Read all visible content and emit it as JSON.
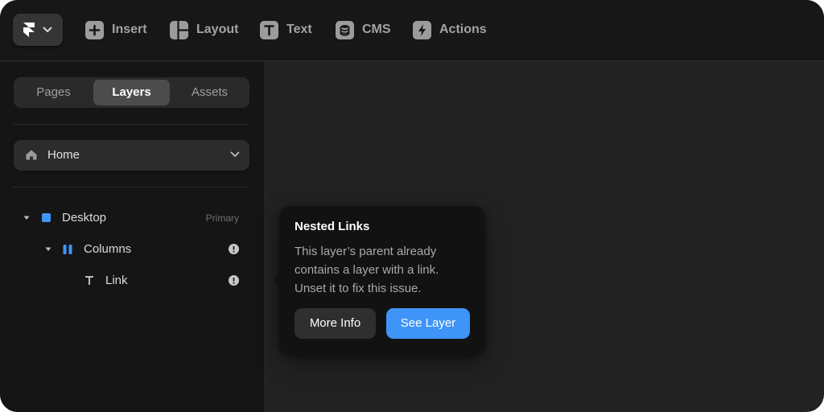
{
  "colors": {
    "accent": "#3f95f7",
    "canvas": "#222222",
    "toolbar_bg": "#171717",
    "sidebar_bg": "#151515",
    "popover_bg": "#121212"
  },
  "toolbar": {
    "logo_icon": "framer-logo-icon",
    "logo_menu_icon": "chevron-down-icon",
    "items": [
      {
        "label": "Insert",
        "icon": "plus-icon"
      },
      {
        "label": "Layout",
        "icon": "layout-icon"
      },
      {
        "label": "Text",
        "icon": "text-icon"
      },
      {
        "label": "CMS",
        "icon": "database-icon"
      },
      {
        "label": "Actions",
        "icon": "bolt-icon"
      }
    ]
  },
  "sidebar": {
    "tabs": [
      {
        "label": "Pages",
        "active": false
      },
      {
        "label": "Layers",
        "active": true
      },
      {
        "label": "Assets",
        "active": false
      }
    ],
    "page_select": {
      "label": "Home",
      "icon": "home-icon"
    },
    "layers": [
      {
        "name": "Desktop",
        "badge": "Primary",
        "icon": "frame-square-icon",
        "expanded": true
      },
      {
        "name": "Columns",
        "icon": "stack-columns-icon",
        "expanded": true,
        "warning": true
      },
      {
        "name": "Link",
        "icon": "text-t-icon",
        "warning": true
      }
    ]
  },
  "popover": {
    "title": "Nested Links",
    "body": "This layer’s parent already contains a layer with a link. Unset it to fix this issue.",
    "secondary_button": "More Info",
    "primary_button": "See Layer"
  }
}
